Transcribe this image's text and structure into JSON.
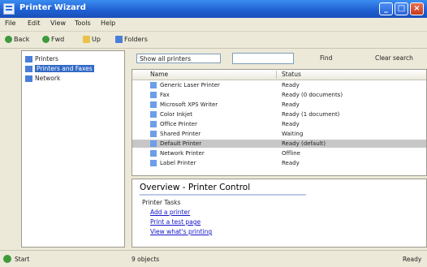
{
  "window": {
    "title": "Printer Wizard",
    "controls": {
      "minimize": "_",
      "maximize": "□",
      "close": "×"
    }
  },
  "menubar": [
    "File",
    "Edit",
    "View",
    "Tools",
    "Help"
  ],
  "toolbar": {
    "back": "Back",
    "forward": "Fwd",
    "up": "Up",
    "folders": "Folders"
  },
  "tree": {
    "items": [
      {
        "label": "Printers",
        "selected": false
      },
      {
        "label": "Printers and Faxes",
        "selected": true
      },
      {
        "label": "Network",
        "selected": false
      }
    ]
  },
  "addr": {
    "filter": "Show all printers",
    "search": "",
    "find": "Find",
    "clear": "Clear search"
  },
  "grid": {
    "columns": [
      "Name",
      "Status"
    ],
    "rows": [
      {
        "name": "Generic Laser Printer",
        "status": "Ready",
        "selected": false
      },
      {
        "name": "Fax",
        "status": "Ready (0 documents)",
        "selected": false
      },
      {
        "name": "Microsoft XPS Writer",
        "status": "Ready",
        "selected": false
      },
      {
        "name": "Color Inkjet",
        "status": "Ready (1 document)",
        "selected": false
      },
      {
        "name": "Office Printer",
        "status": "Ready",
        "selected": false
      },
      {
        "name": "Shared Printer",
        "status": "Waiting",
        "selected": false
      },
      {
        "name": "Default Printer",
        "status": "Ready (default)",
        "selected": true
      },
      {
        "name": "Network Printer",
        "status": "Offline",
        "selected": false
      },
      {
        "name": "Label Printer",
        "status": "Ready",
        "selected": false
      }
    ]
  },
  "details": {
    "title": "Overview - Printer Control",
    "tasks_label": "Printer Tasks",
    "links": [
      "Add a printer",
      "Print a test page",
      "View what's printing"
    ]
  },
  "statusbar": {
    "left": "Start",
    "center": "9 objects",
    "right": "Ready"
  }
}
